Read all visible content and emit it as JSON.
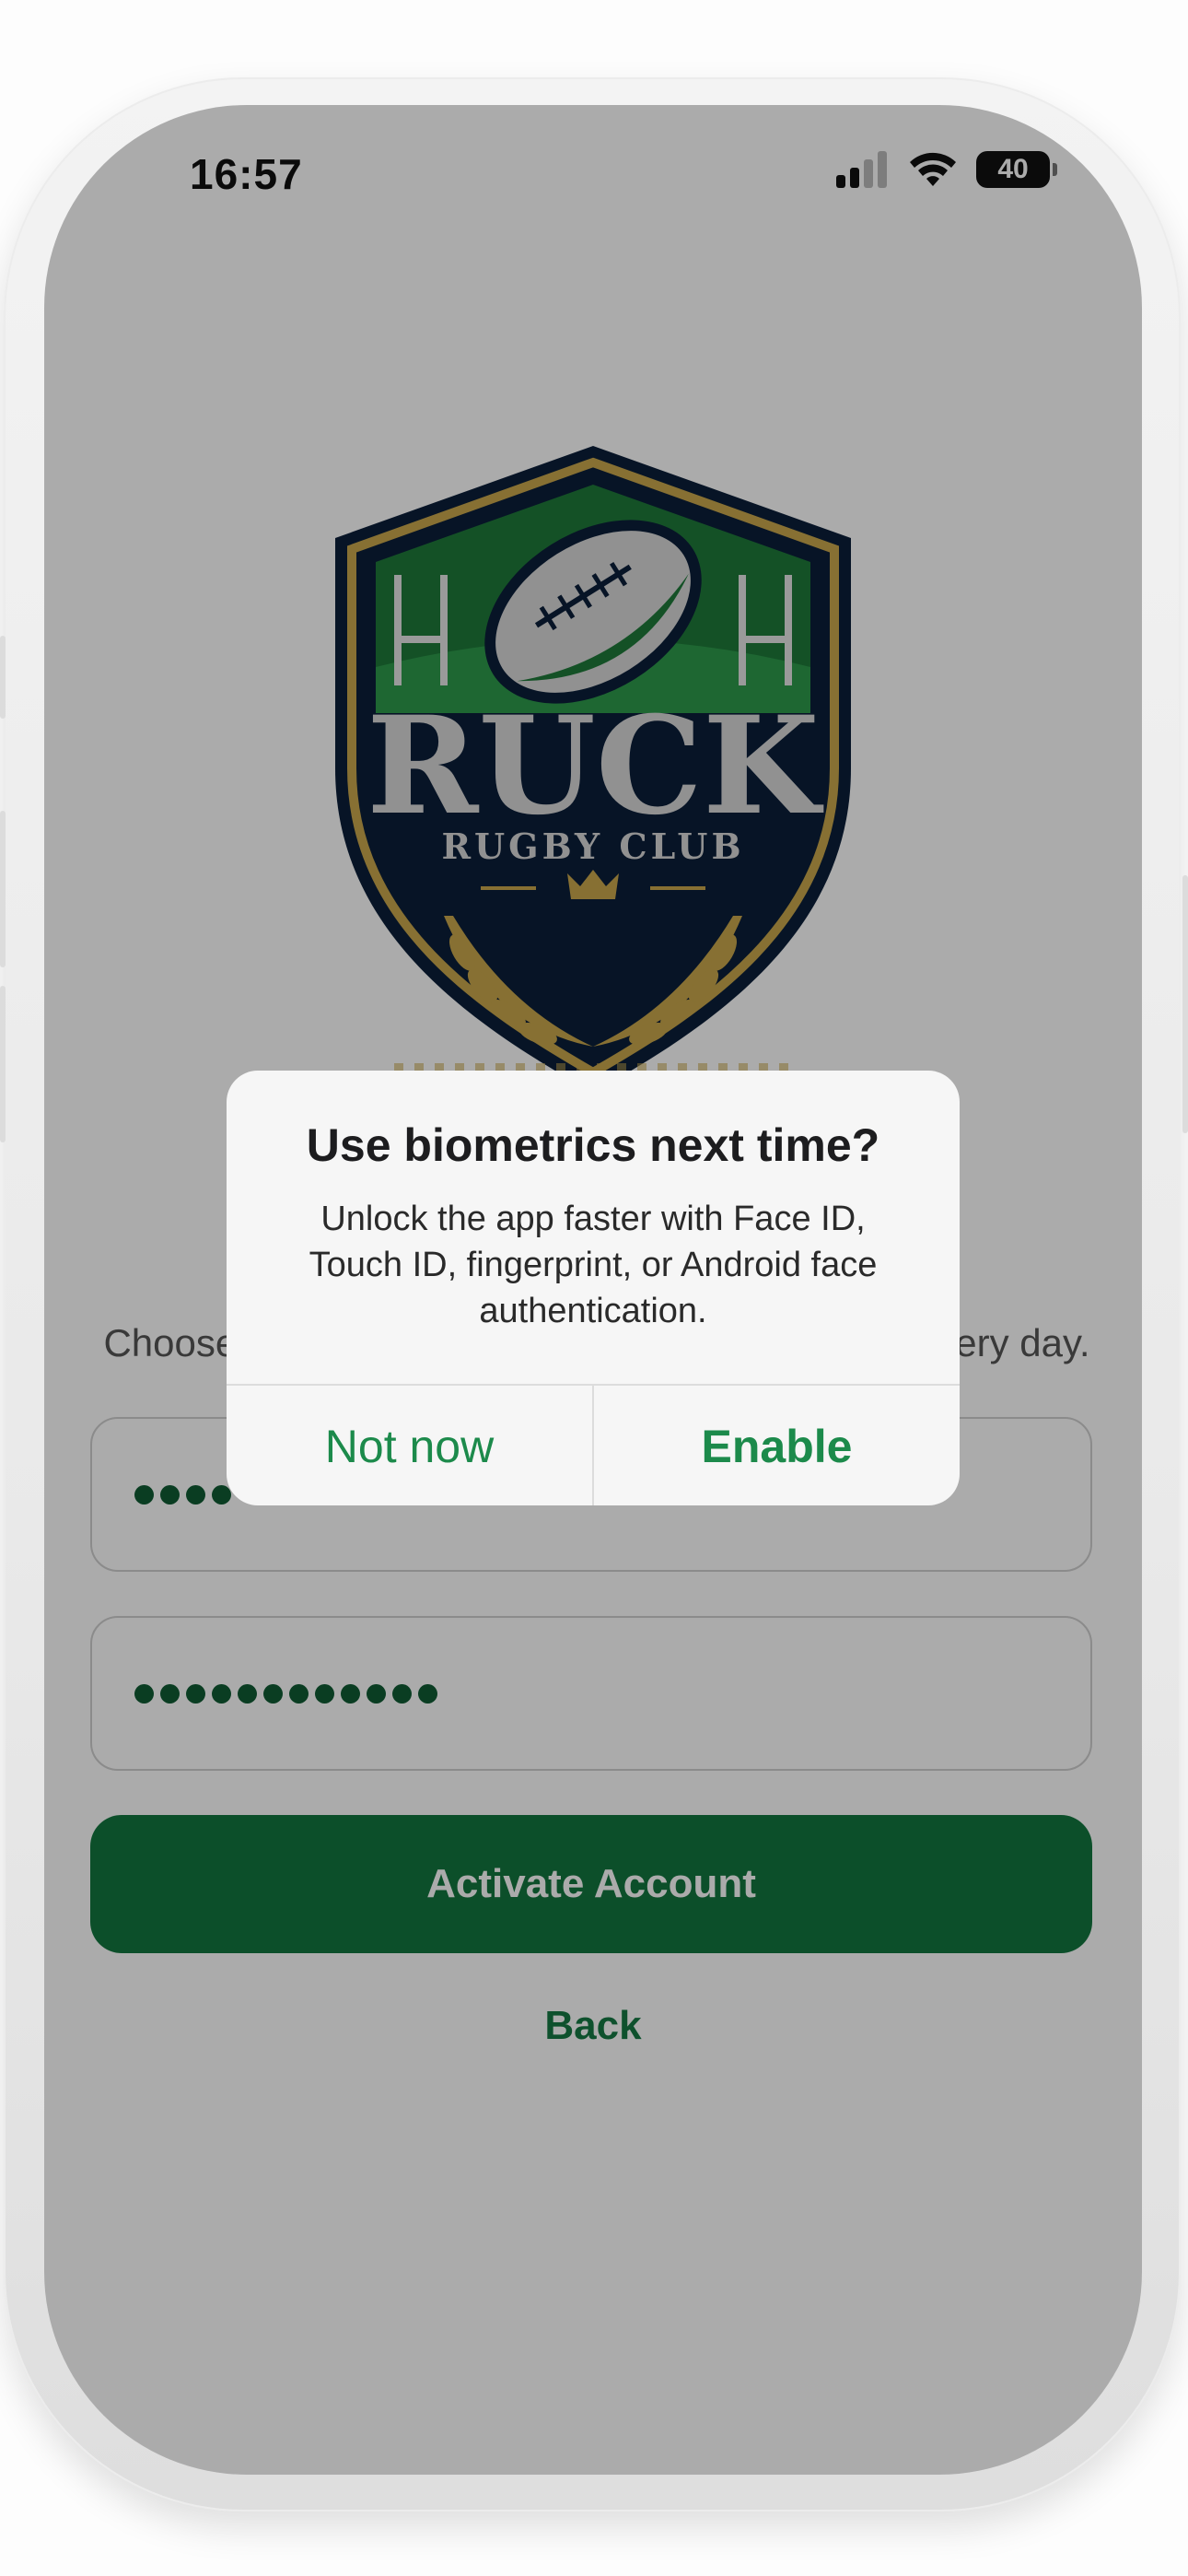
{
  "status_bar": {
    "time": "16:57",
    "battery": "40",
    "icons": [
      "signal-icon",
      "wifi-icon",
      "battery-icon"
    ]
  },
  "logo": {
    "title": "RUCK",
    "subtitle": "RUGBY CLUB",
    "icons": [
      "rugby-ball-icon",
      "goal-posts-icon",
      "crown-icon",
      "laurel-icon"
    ],
    "colors": {
      "navy": "#0b1f3a",
      "gold": "#c9a84c",
      "green": "#1f7a3a",
      "silver": "#d9d9d9"
    }
  },
  "screen": {
    "subtitle_left": "Choose",
    "subtitle_right": "ery day.",
    "field_1_dots": 4,
    "field_2_dots": 12,
    "activate_label": "Activate Account",
    "back_label": "Back",
    "colors": {
      "primary": "#13773f",
      "link": "#157a43",
      "dot": "#0f5c34"
    }
  },
  "dialog": {
    "title": "Use biometrics next time?",
    "body": "Unlock the app faster with Face ID, Touch ID, fingerprint, or Android face authentication.",
    "not_now_label": "Not now",
    "enable_label": "Enable",
    "accent": "#1c8a4b"
  }
}
